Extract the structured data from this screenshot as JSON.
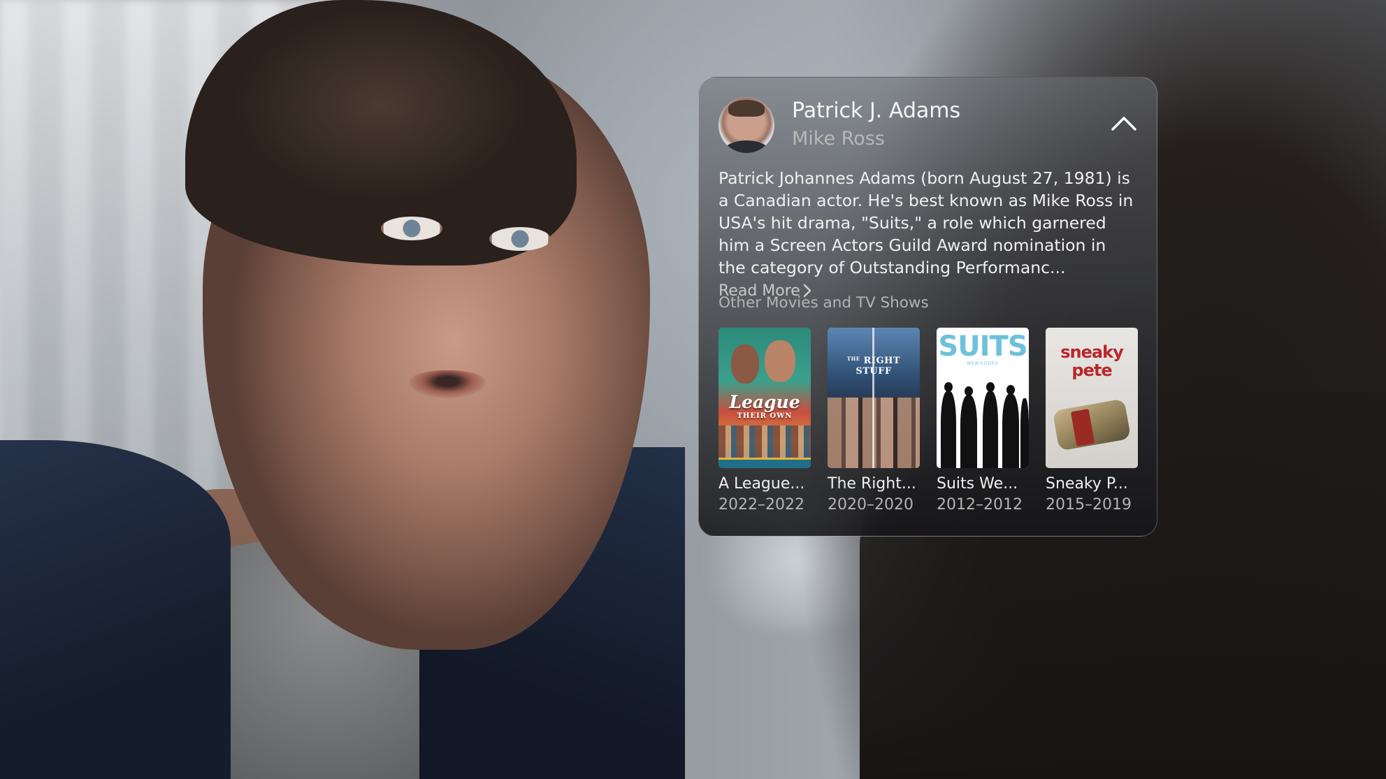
{
  "cast_panel": {
    "actor_name": "Patrick J. Adams",
    "role_name": "Mike Ross",
    "bio": "Patrick Johannes Adams (born August 27, 1981) is a Canadian actor. He's best known as Mike Ross in USA's hit drama, \"Suits,\" a role which garnered him a Screen Actors Guild Award nomination in the category of Outstanding Performanc...",
    "read_more_label": "Read More",
    "section_title": "Other Movies and TV Shows",
    "titles": [
      {
        "name": "A League...",
        "years": "2022–2022",
        "poster_text": "League",
        "poster_subtext": "THEIR OWN"
      },
      {
        "name": "The Right...",
        "years": "2020–2020",
        "poster_text": "RIGHT STUFF",
        "poster_subtext": "THE"
      },
      {
        "name": "Suits We...",
        "years": "2012–2012",
        "poster_text": "SUITS",
        "poster_subtext": "WEBISODES"
      },
      {
        "name": "Sneaky P...",
        "years": "2015–2019",
        "poster_text": "sneaky pete"
      }
    ]
  },
  "colors": {
    "panel_text": "#f0f0f0",
    "secondary_text": "#b4b4b4",
    "suits_logo": "#6ec1da",
    "sneaky_pete_logo": "#b8262a"
  },
  "icons": {
    "collapse": "chevron-up-icon",
    "read_more": "chevron-right-icon"
  }
}
